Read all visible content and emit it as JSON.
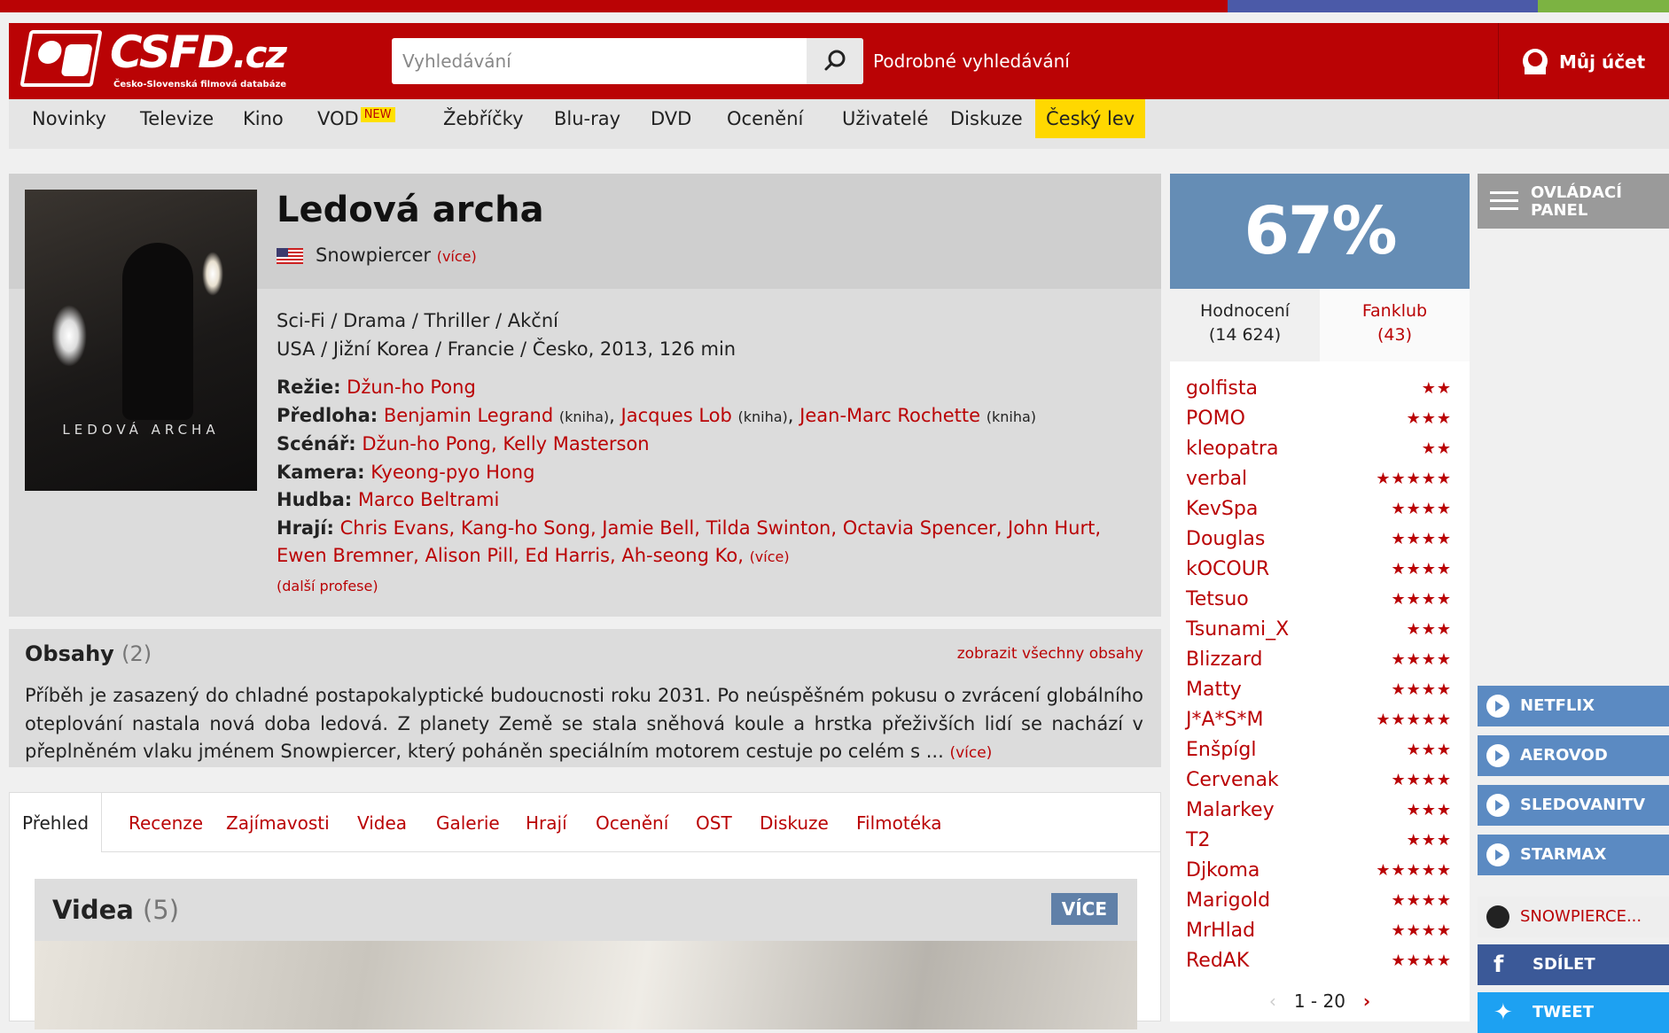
{
  "header": {
    "logo_text": "CSFD",
    "logo_suffix": ".cz",
    "logo_tagline": "Česko-Slovenská filmová databáze",
    "search_placeholder": "Vyhledávání",
    "advanced_search": "Podrobné vyhledávání",
    "account": "Můj účet"
  },
  "nav": {
    "items": [
      "Novinky",
      "Televize",
      "Kino",
      "VOD",
      "Žebříčky",
      "Blu-ray",
      "DVD",
      "Ocenění",
      "Uživatelé",
      "Diskuze",
      "Český lev"
    ],
    "new_badge": "NEW"
  },
  "film": {
    "title": "Ledová archa",
    "original_title": "Snowpiercer",
    "more": "(více)",
    "genres": "Sci-Fi / Drama / Thriller / Akční",
    "origin": "USA / Jižní Korea / Francie / Česko, 2013, 126 min",
    "poster_title": "LEDOVÁ ARCHA",
    "directing_label": "Režie:",
    "directing": "Džun-ho Pong",
    "source_label": "Předloha:",
    "source": [
      "Benjamin Legrand",
      "Jacques Lob",
      "Jean-Marc Rochette"
    ],
    "book_note": "(kniha)",
    "screenplay_label": "Scénář:",
    "screenplay": "Džun-ho Pong, Kelly Masterson",
    "camera_label": "Kamera:",
    "camera": "Kyeong-pyo Hong",
    "music_label": "Hudba:",
    "music": "Marco Beltrami",
    "cast_label": "Hrají:",
    "cast_line1": "Chris Evans, Kang-ho Song, Jamie Bell, Tilda Swinton, Octavia Spencer, John Hurt,",
    "cast_line2": "Ewen Bremner, Alison Pill, Ed Harris, Ah-seong Ko,",
    "cast_more": "(více)",
    "other_professions": "(další profese)"
  },
  "plot": {
    "title": "Obsahy",
    "count": "(2)",
    "show_all": "zobrazit všechny obsahy",
    "text": "Příběh je zasazený do chladné postapokalyptické budoucnosti roku 2031. Po neúspěšném pokusu o zvrácení globálního oteplování nastala nová doba ledová. Z planety Země se stala sněhová koule a hrstka přeživších lidí se nachází v přeplněném vlaku jménem Snowpiercer, který poháněn speciálním motorem cestuje po celém s ...",
    "more": "(více)"
  },
  "tabs": [
    "Přehled",
    "Recenze",
    "Zajímavosti",
    "Videa",
    "Galerie",
    "Hrají",
    "Ocenění",
    "OST",
    "Diskuze",
    "Filmotéka"
  ],
  "videos": {
    "title": "Videa",
    "count": "(5)",
    "more_button": "VÍCE"
  },
  "rating": {
    "percent": "67%",
    "tab_ratings": "Hodnocení",
    "tab_ratings_count": "(14 624)",
    "tab_fanclub": "Fanklub",
    "tab_fanclub_count": "(43)",
    "users": [
      {
        "name": "golfista",
        "stars": 2
      },
      {
        "name": "POMO",
        "stars": 3
      },
      {
        "name": "kleopatra",
        "stars": 2
      },
      {
        "name": "verbal",
        "stars": 5
      },
      {
        "name": "KevSpa",
        "stars": 4
      },
      {
        "name": "Douglas",
        "stars": 4
      },
      {
        "name": "kOCOUR",
        "stars": 4
      },
      {
        "name": "Tetsuo",
        "stars": 4
      },
      {
        "name": "Tsunami_X",
        "stars": 3
      },
      {
        "name": "Blizzard",
        "stars": 4
      },
      {
        "name": "Matty",
        "stars": 4
      },
      {
        "name": "J*A*S*M",
        "stars": 5
      },
      {
        "name": "Enšpígl",
        "stars": 3
      },
      {
        "name": "Cervenak",
        "stars": 4
      },
      {
        "name": "Malarkey",
        "stars": 3
      },
      {
        "name": "T2",
        "stars": 3
      },
      {
        "name": "Djkoma",
        "stars": 5
      },
      {
        "name": "Marigold",
        "stars": 4
      },
      {
        "name": "MrHlad",
        "stars": 4
      },
      {
        "name": "RedAK",
        "stars": 4
      }
    ],
    "pager": "1 - 20"
  },
  "sidebar": {
    "control_panel_line1": "OVLÁDACÍ",
    "control_panel_line2": "PANEL",
    "vod": [
      "NETFLIX",
      "AEROVOD",
      "SLEDOVANITV",
      "STARMAX"
    ],
    "website": "SNOWPIERCE...",
    "share": "SDÍLET",
    "tweet": "TWEET"
  },
  "colors": {
    "brand_red": "#ba0305",
    "rating_blue": "#658db5",
    "vod_blue": "#5b8ac2",
    "facebook": "#3b5998",
    "twitter": "#1da1f2",
    "highlight_yellow": "#ffd800"
  }
}
